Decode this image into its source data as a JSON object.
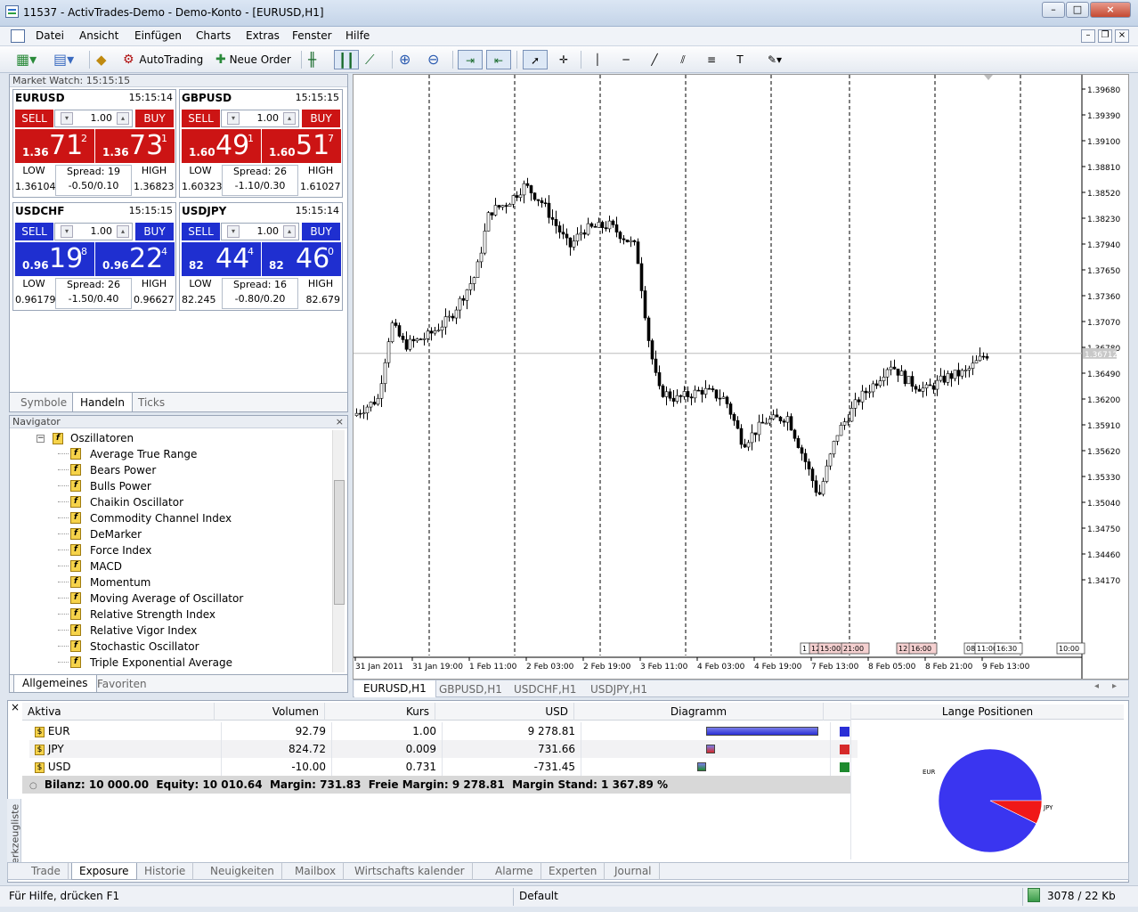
{
  "window": {
    "title": "11537 - ActivTrades-Demo - Demo-Konto - [EURUSD,H1]",
    "min": "–",
    "max": "□",
    "close": "×"
  },
  "menu": [
    "Datei",
    "Ansicht",
    "Einfügen",
    "Charts",
    "Extras",
    "Fenster",
    "Hilfe"
  ],
  "toolbar": {
    "autotrading": "AutoTrading",
    "new_order": "Neue Order"
  },
  "market_watch": {
    "title": "Market Watch: 15:15:15",
    "sell": "SELL",
    "buy": "BUY",
    "low": "LOW",
    "high": "HIGH",
    "symbols": [
      {
        "sym": "EURUSD",
        "time": "15:15:14",
        "lot": "1.00",
        "bid_small": "1.36",
        "bid_big": "71",
        "bid_sup": "2",
        "ask_small": "1.36",
        "ask_big": "73",
        "ask_sup": "1",
        "spread": "Spread: 19",
        "sw": "-0.50/0.10",
        "low": "1.36104",
        "high": "1.36823",
        "color": "#cc1414"
      },
      {
        "sym": "GBPUSD",
        "time": "15:15:15",
        "lot": "1.00",
        "bid_small": "1.60",
        "bid_big": "49",
        "bid_sup": "1",
        "ask_small": "1.60",
        "ask_big": "51",
        "ask_sup": "7",
        "spread": "Spread: 26",
        "sw": "-1.10/0.30",
        "low": "1.60323",
        "high": "1.61027",
        "color": "#cc1414"
      },
      {
        "sym": "USDCHF",
        "time": "15:15:15",
        "lot": "1.00",
        "bid_small": "0.96",
        "bid_big": "19",
        "bid_sup": "8",
        "ask_small": "0.96",
        "ask_big": "22",
        "ask_sup": "4",
        "spread": "Spread: 26",
        "sw": "-1.50/0.40",
        "low": "0.96179",
        "high": "0.96627",
        "color": "#1f2fd0"
      },
      {
        "sym": "USDJPY",
        "time": "15:15:14",
        "lot": "1.00",
        "bid_small": "82",
        "bid_big": "44",
        "bid_sup": "4",
        "ask_small": "82",
        "ask_big": "46",
        "ask_sup": "0",
        "spread": "Spread: 16",
        "sw": "-0.80/0.20",
        "low": "82.245",
        "high": "82.679",
        "color": "#1f2fd0"
      }
    ],
    "tabs": [
      "Symbole",
      "Handeln",
      "Ticks"
    ]
  },
  "navigator": {
    "title": "Navigator",
    "folder": "Oszillatoren",
    "items": [
      "Average True Range",
      "Bears Power",
      "Bulls Power",
      "Chaikin Oscillator",
      "Commodity Channel Index",
      "DeMarker",
      "Force Index",
      "MACD",
      "Momentum",
      "Moving Average of Oscillator",
      "Relative Strength Index",
      "Relative Vigor Index",
      "Stochastic Oscillator",
      "Triple Exponential Average"
    ],
    "tabs": [
      "Allgemeines",
      "Favoriten"
    ]
  },
  "chart": {
    "price_labels": [
      "1.39680",
      "1.39390",
      "1.39100",
      "1.38810",
      "1.38520",
      "1.38230",
      "1.37940",
      "1.37650",
      "1.37360",
      "1.37070",
      "1.36780",
      "1.36490",
      "1.36200",
      "1.35910",
      "1.35620",
      "1.35330",
      "1.35040",
      "1.34750",
      "1.34460",
      "1.34170"
    ],
    "current": "1.36712",
    "time_labels": [
      "31 Jan 2011",
      "31 Jan 19:00",
      "1 Feb 11:00",
      "2 Feb 03:00",
      "2 Feb 19:00",
      "3 Feb 11:00",
      "4 Feb 03:00",
      "4 Feb 19:00",
      "7 Feb 13:00",
      "8 Feb 05:00",
      "8 Feb 21:00",
      "9 Feb 13:00"
    ],
    "markers": [
      "1",
      "12",
      "15:00",
      "21:00",
      "12",
      "16:00",
      "08",
      "11:00",
      "16:30",
      "10:00"
    ],
    "tabs": [
      "EURUSD,H1",
      "GBPUSD,H1",
      "USDCHF,H1",
      "USDJPY,H1"
    ]
  },
  "exposure": {
    "headers": [
      "Aktiva",
      "Volumen",
      "Kurs",
      "USD",
      "Diagramm"
    ],
    "rows": [
      {
        "asset": "EUR",
        "vol": "92.79",
        "kurs": "1.00",
        "usd": "9 278.81",
        "bar": 0.9,
        "color": "#2a2fd6"
      },
      {
        "asset": "JPY",
        "vol": "824.72",
        "kurs": "0.009",
        "usd": "731.66",
        "bar": 0.07,
        "color": "#d62a2a"
      },
      {
        "asset": "USD",
        "vol": "-10.00",
        "kurs": "0.731",
        "usd": "-731.45",
        "bar": -0.07,
        "color": "#1e8a2e"
      }
    ],
    "summary": "Bilanz: 10 000.00  Equity: 10 010.64  Margin: 731.83  Freie Margin: 9 278.81  Margin Stand: 1 367.89 %",
    "pie_title": "Lange Positionen",
    "pie": [
      {
        "label": "EUR",
        "value": 92.7,
        "color": "#3a35f0"
      },
      {
        "label": "JPY",
        "value": 7.3,
        "color": "#f01818"
      }
    ]
  },
  "terminal_tabs": [
    "Trade",
    "Exposure",
    "Historie",
    "Neuigkeiten",
    "Mailbox",
    "Wirtschafts kalender",
    "Alarme",
    "Experten",
    "Journal"
  ],
  "toolbox_label": "Werkzeugliste",
  "status": {
    "help": "Für Hilfe, drücken F1",
    "profile": "Default",
    "traffic": "3078 / 22 Kb"
  }
}
